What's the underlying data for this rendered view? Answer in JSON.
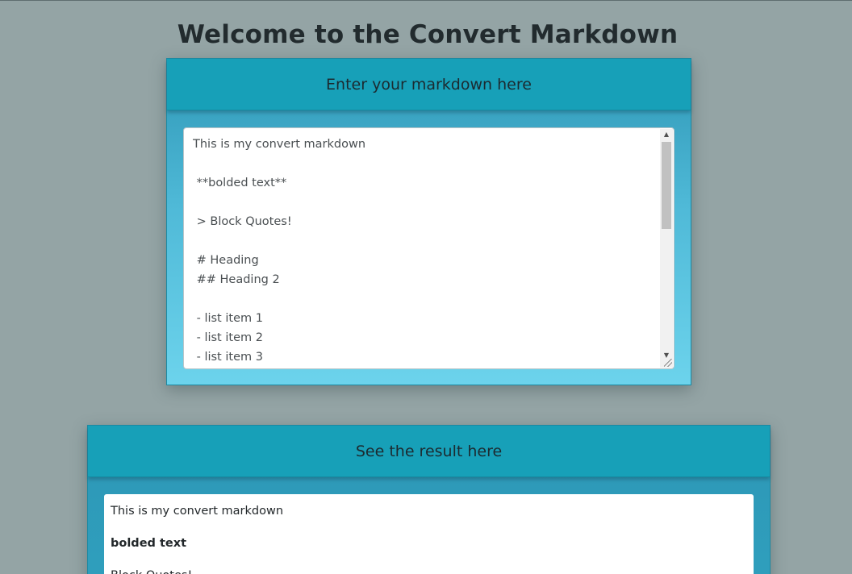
{
  "page": {
    "title": "Welcome to the Convert Markdown"
  },
  "input_card": {
    "header": "Enter your markdown here",
    "textarea_value": "This is my convert markdown\n\n **bolded text**\n\n > Block Quotes!\n\n # Heading\n ## Heading 2\n\n - list item 1\n - list item 2\n - list item 3"
  },
  "output_card": {
    "header": "See the result here",
    "result": {
      "paragraph": "This is my convert markdown",
      "bold": "bolded text",
      "blockquote": "Block Quotes!"
    }
  },
  "colors": {
    "page_background": "#94a4a5",
    "card_header": "#17a0b8",
    "card_gradient_top": "#2e97b6",
    "card_gradient_bottom": "#6cd3ec"
  },
  "icons": {
    "scroll_up": "triangle-up-icon",
    "scroll_down": "triangle-down-icon",
    "resize": "resize-grip-icon"
  }
}
